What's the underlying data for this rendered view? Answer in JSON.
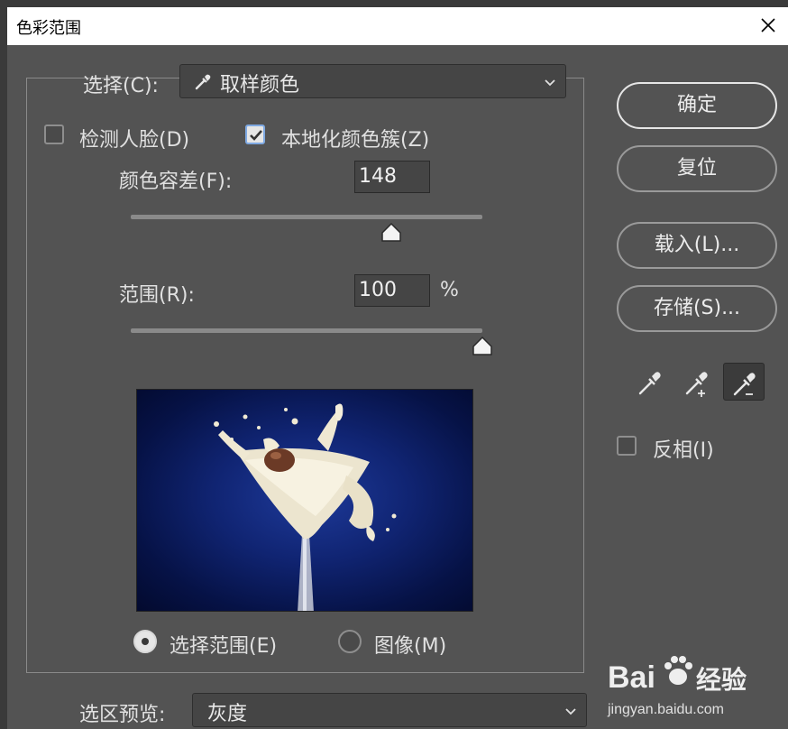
{
  "window": {
    "title": "色彩范围"
  },
  "select_row": {
    "label": "选择(C):",
    "value": "取样颜色",
    "icon": "eyedropper-icon"
  },
  "checks": {
    "face_label": "检测人脸(D)",
    "face_checked": false,
    "localize_label": "本地化颜色簇(Z)",
    "localize_checked": true
  },
  "fuzziness": {
    "label": "颜色容差(F):",
    "value": "148",
    "slider_fraction": 0.74
  },
  "range": {
    "label": "范围(R):",
    "value": "100",
    "unit": "%",
    "slider_fraction": 1.0
  },
  "preview_mode": {
    "selection_label": "选择范围(E)",
    "image_label": "图像(M)",
    "selected": "selection"
  },
  "selection_preview": {
    "label": "选区预览:",
    "value": "灰度"
  },
  "buttons": {
    "ok": "确定",
    "reset": "复位",
    "load": "载入(L)...",
    "save": "存储(S)..."
  },
  "tools": [
    "eyedropper-icon",
    "eyedropper-plus-icon",
    "eyedropper-minus-icon"
  ],
  "invert": {
    "label": "反相(I)",
    "checked": false
  },
  "watermark": {
    "brand": "Bai",
    "cn": "经验",
    "url": "jingyan.baidu.com"
  },
  "colors": {
    "dialog_bg": "#535353",
    "field_bg": "#454545",
    "accent": "#7fa9e2",
    "preview_bg": "#0b1c62"
  }
}
